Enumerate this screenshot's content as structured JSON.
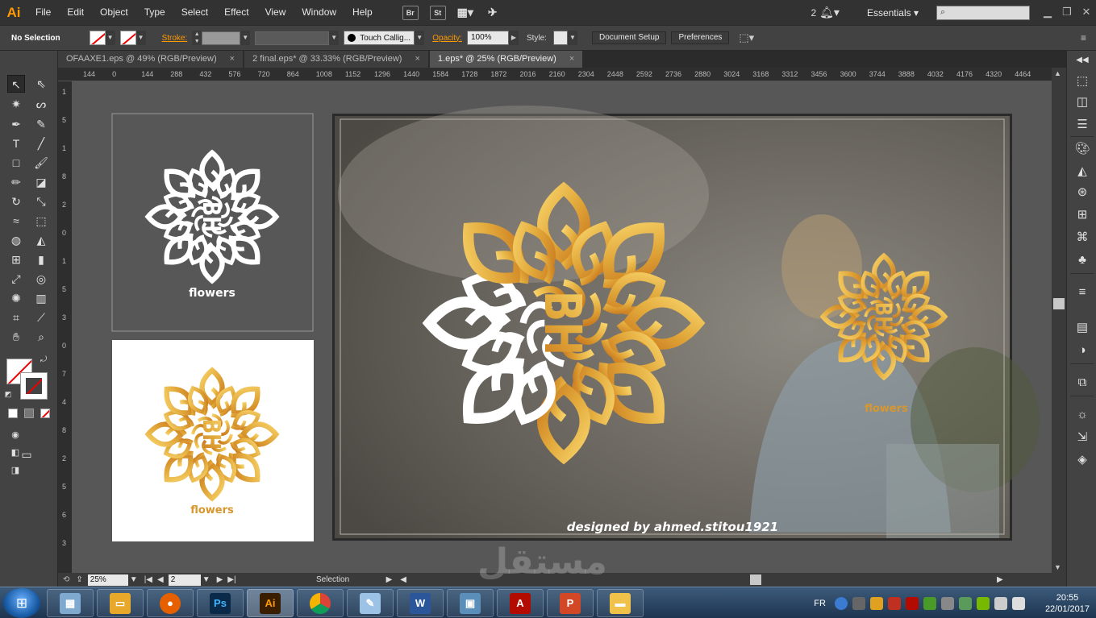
{
  "app": {
    "logo": "Ai"
  },
  "menu": [
    "File",
    "Edit",
    "Object",
    "Type",
    "Select",
    "Effect",
    "View",
    "Window",
    "Help"
  ],
  "menubar_icons": [
    "Br",
    "St"
  ],
  "workspace": {
    "notification_count": "2",
    "name": "Essentials"
  },
  "control": {
    "selection_label": "No Selection",
    "stroke_label": "Stroke:",
    "brush": "Touch Callig...",
    "opacity_label": "Opacity:",
    "opacity": "100%",
    "style_label": "Style:",
    "document_setup": "Document Setup",
    "preferences": "Preferences"
  },
  "tabs": [
    {
      "label": "OFAAXE1.eps @ 49% (RGB/Preview)",
      "active": false
    },
    {
      "label": "2 final.eps* @ 33.33% (RGB/Preview)",
      "active": false
    },
    {
      "label": "1.eps* @ 25% (RGB/Preview)",
      "active": true
    }
  ],
  "ruler_h": [
    "144",
    "0",
    "144",
    "288",
    "432",
    "576",
    "720",
    "864",
    "1008",
    "1152",
    "1296",
    "1440",
    "1584",
    "1728",
    "1872",
    "2016",
    "2160",
    "2304",
    "2448",
    "2592",
    "2736",
    "2880",
    "3024",
    "3168",
    "3312",
    "3456",
    "3600",
    "3744",
    "3888",
    "4032",
    "4176",
    "4320",
    "4464"
  ],
  "ruler_v": [
    "1",
    "5",
    "1",
    "8",
    "2",
    "0",
    "1",
    "5",
    "3",
    "0",
    "7",
    "4",
    "8",
    "2",
    "5",
    "6",
    "3"
  ],
  "artwork": {
    "logo_letters": "BH",
    "logo_text": "flowers",
    "credit": "designed by ahmed.stitou1921",
    "gold": "#e2a93b",
    "white": "#ffffff"
  },
  "status": {
    "zoom": "25%",
    "page": "2",
    "tool": "Selection"
  },
  "taskbar": {
    "apps": [
      "File Explorer",
      "Firefox",
      "Photoshop",
      "Illustrator",
      "Chrome",
      "Notes",
      "Word",
      "Photos",
      "Acrobat",
      "PowerPoint",
      "Folder"
    ],
    "language": "FR",
    "time": "20:55",
    "date": "22/01/2017"
  },
  "watermark": "مستقل"
}
